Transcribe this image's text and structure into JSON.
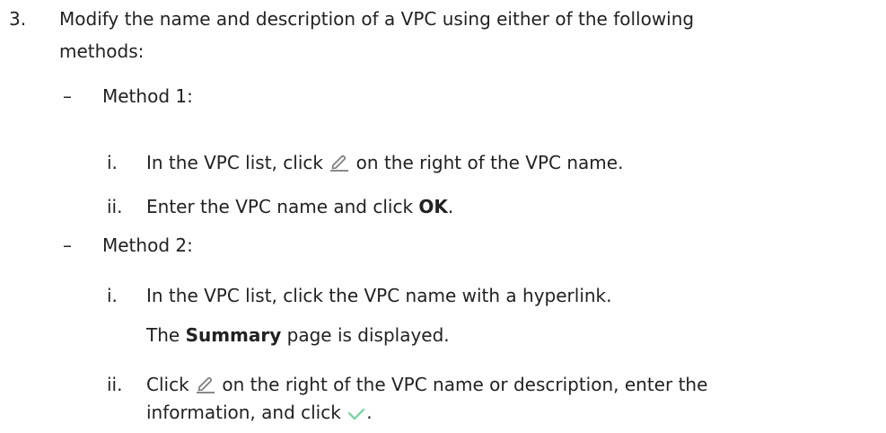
{
  "step": {
    "number": "3.",
    "line1": "Modify the name and description of a VPC using either of the following",
    "line2": "methods:"
  },
  "method1": {
    "dash": "–",
    "title": "Method 1:",
    "sub_i": {
      "num": "i.",
      "before": "In the VPC list, click",
      "icon": "edit-pencil-icon",
      "after": "on the right of the VPC name."
    },
    "sub_ii": {
      "num": "ii.",
      "before": "Enter the VPC name and click ",
      "bold": "OK",
      "after": "."
    }
  },
  "method2": {
    "dash": "–",
    "title": "Method 2:",
    "sub_i": {
      "num": "i.",
      "text": "In the VPC list, click the VPC name with a hyperlink.",
      "result_before": "The ",
      "result_bold": "Summary",
      "result_after": " page is displayed."
    },
    "sub_ii": {
      "num": "ii.",
      "before": "Click",
      "icon": "edit-pencil-icon",
      "after": "on the right of the VPC name or description, enter the",
      "line2_before": "information, and click",
      "check_icon": "checkmark-icon",
      "line2_after": "."
    }
  },
  "colors": {
    "text": "#222222",
    "pencil": "#7a7a7a",
    "check": "#7ed3a6"
  }
}
